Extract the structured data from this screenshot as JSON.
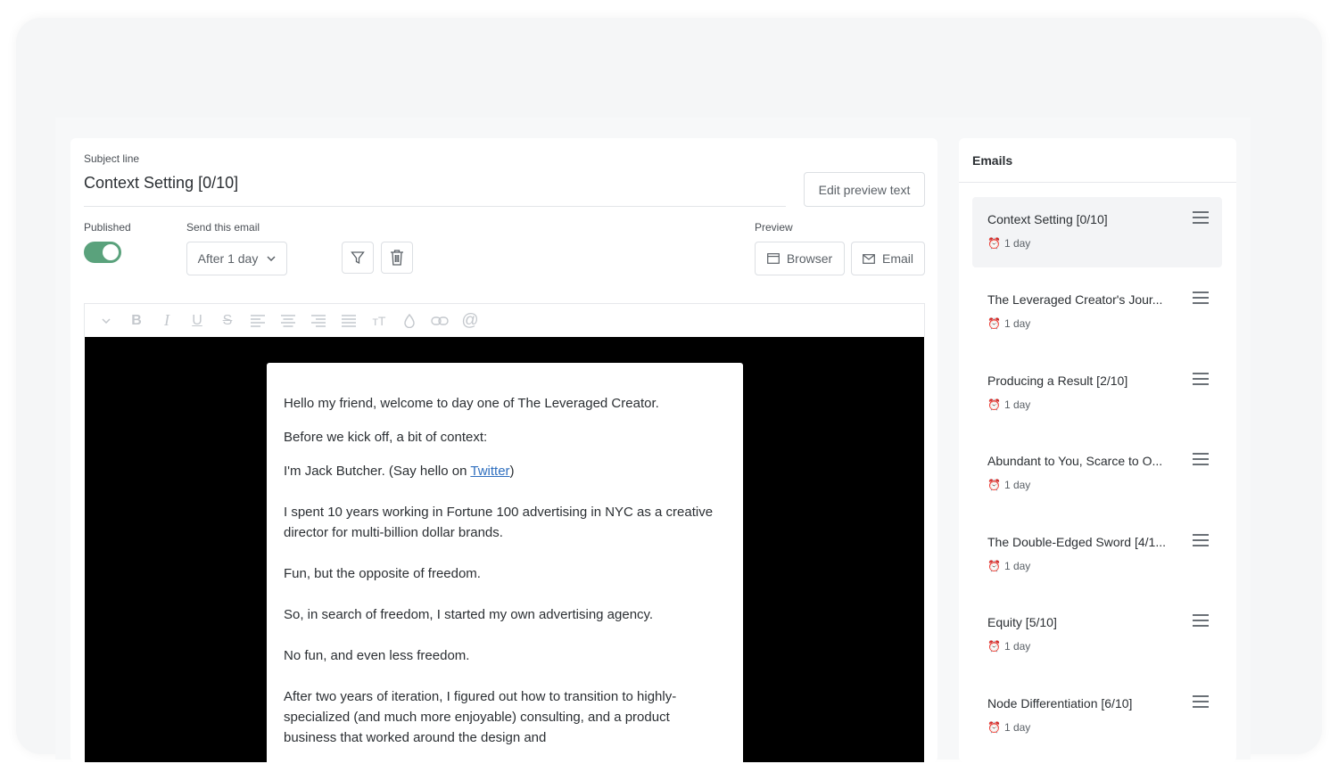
{
  "subject": {
    "label": "Subject line",
    "title": "Context Setting [0/10]",
    "edit_preview_label": "Edit preview text"
  },
  "published": {
    "label": "Published",
    "on": true
  },
  "send": {
    "label": "Send this email",
    "value": "After 1 day"
  },
  "preview": {
    "label": "Preview",
    "browser_label": "Browser",
    "email_label": "Email"
  },
  "toolbar_icons": [
    "chevron-down-icon",
    "bold-icon",
    "italic-icon",
    "underline-icon",
    "strikethrough-icon",
    "align-left-icon",
    "align-center-icon",
    "align-right-icon",
    "justify-icon",
    "text-size-icon",
    "color-drop-icon",
    "link-icon",
    "mention-icon"
  ],
  "email_body": {
    "p1": "Hello my friend, welcome to day one of The Leveraged Creator.",
    "p2": "Before we kick off, a bit of context:",
    "p3_before": "I'm Jack Butcher. (Say hello on ",
    "p3_link": "Twitter",
    "p3_after": ")",
    "p4": "I spent 10 years working in Fortune 100 advertising in NYC as a creative director for multi-billion dollar brands.",
    "p5": "Fun, but the opposite of freedom.",
    "p6": "So, in search of freedom, I started my own advertising agency.",
    "p7": "No fun, and even less freedom.",
    "p8": "After two years of iteration, I figured out how to transition to highly-specialized (and much more enjoyable) consulting, and a product business that worked around the design and"
  },
  "sidebar": {
    "title": "Emails",
    "items": [
      {
        "title": "Context Setting [0/10]",
        "delay": "1 day"
      },
      {
        "title": "The Leveraged Creator's Jour...",
        "delay": "1 day"
      },
      {
        "title": "Producing a Result [2/10]",
        "delay": "1 day"
      },
      {
        "title": "Abundant to You, Scarce to O...",
        "delay": "1 day"
      },
      {
        "title": "The Double-Edged Sword [4/1...",
        "delay": "1 day"
      },
      {
        "title": "Equity [5/10]",
        "delay": "1 day"
      },
      {
        "title": "Node Differentiation [6/10]",
        "delay": "1 day"
      }
    ]
  },
  "colors": {
    "toggle_on": "#5aa27c",
    "link": "#2f6fbf",
    "editor_bg": "#000000"
  }
}
